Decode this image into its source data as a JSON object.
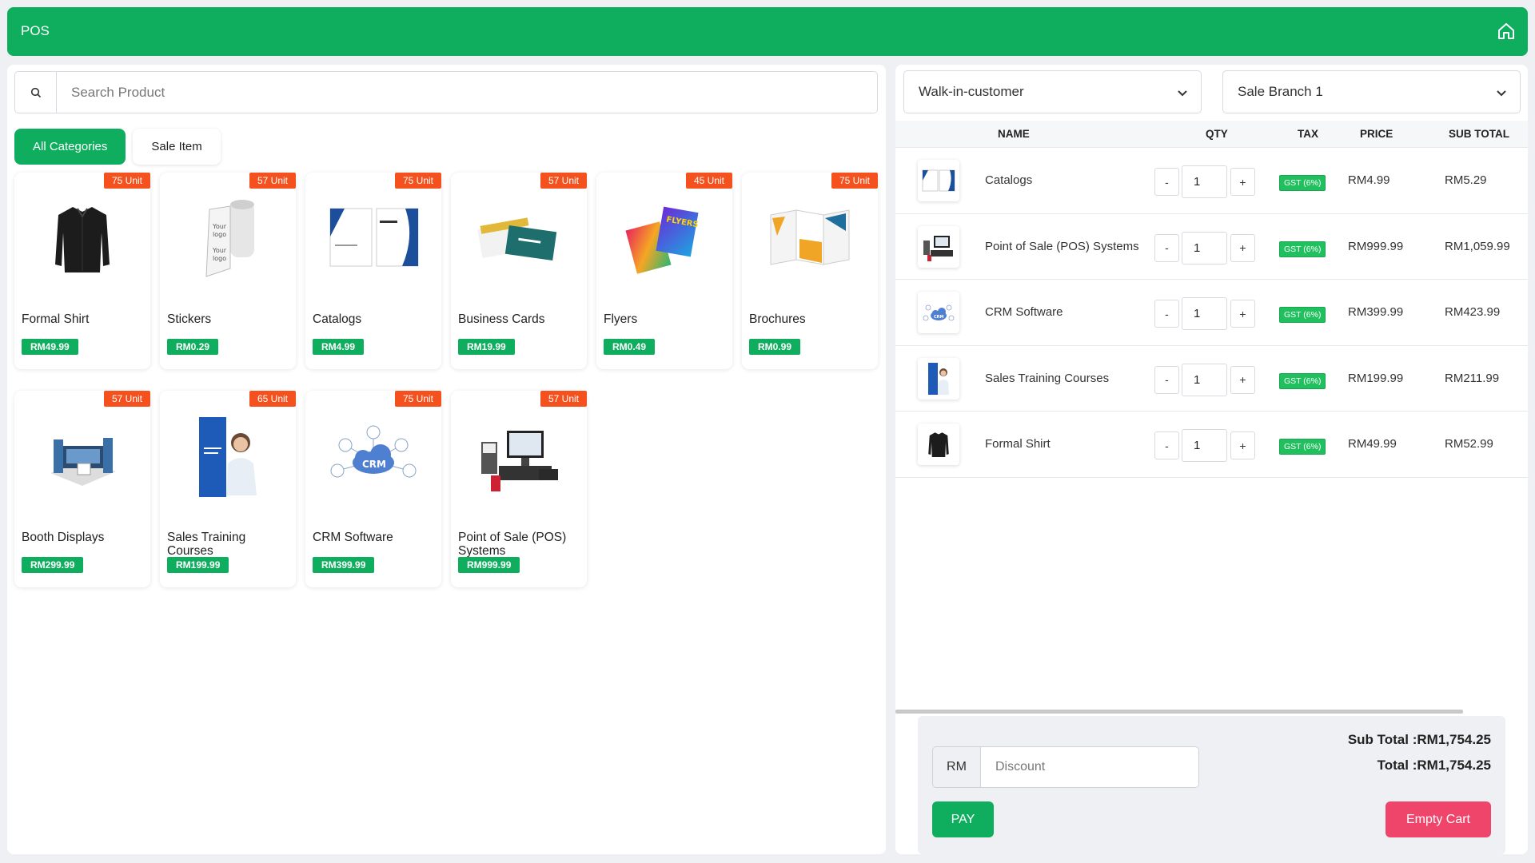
{
  "header": {
    "title": "POS",
    "home_icon": "home-icon"
  },
  "search": {
    "placeholder": "Search Product",
    "icon": "search-icon"
  },
  "categories": [
    {
      "label": "All Categories",
      "active": true
    },
    {
      "label": "Sale Item",
      "active": false
    }
  ],
  "products": [
    {
      "name": "Formal Shirt",
      "stock": "75 Unit",
      "price": "RM49.99",
      "image": "shirt"
    },
    {
      "name": "Stickers",
      "stock": "57 Unit",
      "price": "RM0.29",
      "image": "stickers"
    },
    {
      "name": "Catalogs",
      "stock": "75 Unit",
      "price": "RM4.99",
      "image": "catalogs"
    },
    {
      "name": "Business Cards",
      "stock": "57 Unit",
      "price": "RM19.99",
      "image": "business-cards"
    },
    {
      "name": "Flyers",
      "stock": "45 Unit",
      "price": "RM0.49",
      "image": "flyers"
    },
    {
      "name": "Brochures",
      "stock": "75 Unit",
      "price": "RM0.99",
      "image": "brochures"
    },
    {
      "name": "Booth Displays",
      "stock": "57 Unit",
      "price": "RM299.99",
      "image": "booth"
    },
    {
      "name": "Sales Training Courses",
      "stock": "65 Unit",
      "price": "RM199.99",
      "image": "training"
    },
    {
      "name": "CRM Software",
      "stock": "75 Unit",
      "price": "RM399.99",
      "image": "crm"
    },
    {
      "name": "Point of Sale (POS) Systems",
      "stock": "57 Unit",
      "price": "RM999.99",
      "image": "pos"
    }
  ],
  "cart": {
    "customer": "Walk-in-customer",
    "branch": "Sale Branch 1",
    "columns": {
      "name": "NAME",
      "qty": "QTY",
      "tax": "TAX",
      "price": "PRICE",
      "subtotal": "SUB TOTAL"
    },
    "items": [
      {
        "name": "Catalogs",
        "qty": "1",
        "tax": "GST (6%)",
        "price": "RM4.99",
        "subtotal": "RM5.29",
        "image": "catalogs"
      },
      {
        "name": "Point of Sale (POS) Systems",
        "qty": "1",
        "tax": "GST (6%)",
        "price": "RM999.99",
        "subtotal": "RM1,059.99",
        "image": "pos"
      },
      {
        "name": "CRM Software",
        "qty": "1",
        "tax": "GST (6%)",
        "price": "RM399.99",
        "subtotal": "RM423.99",
        "image": "crm"
      },
      {
        "name": "Sales Training Courses",
        "qty": "1",
        "tax": "GST (6%)",
        "price": "RM199.99",
        "subtotal": "RM211.99",
        "image": "training"
      },
      {
        "name": "Formal Shirt",
        "qty": "1",
        "tax": "GST (6%)",
        "price": "RM49.99",
        "subtotal": "RM52.99",
        "image": "shirt"
      }
    ],
    "minus_label": "-",
    "plus_label": "+"
  },
  "summary": {
    "subtotal_label": "Sub Total :",
    "subtotal": "RM1,754.25",
    "total_label": "Total :",
    "total": "RM1,754.25",
    "currency": "RM",
    "discount_placeholder": "Discount",
    "pay_label": "PAY",
    "empty_label": "Empty Cart"
  },
  "colors": {
    "primary": "#0fae5f",
    "badge": "#f4511e",
    "danger": "#f0456b",
    "tax": "#21c05f"
  }
}
